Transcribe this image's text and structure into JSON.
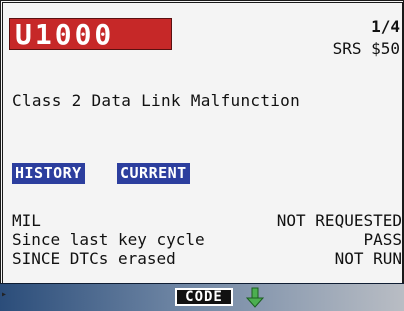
{
  "dtc": {
    "code": "U1000",
    "page": "1/4",
    "module": "SRS $50",
    "description": "Class 2 Data Link Malfunction"
  },
  "badges": {
    "history": "HISTORY",
    "current": "CURRENT",
    "color": "#2c3e9e"
  },
  "status_rows": [
    {
      "label": "MIL",
      "value": "NOT REQUESTED"
    },
    {
      "label": "Since last key cycle",
      "value": "PASS"
    },
    {
      "label": "SINCE DTCs erased",
      "value": "NOT RUN"
    }
  ],
  "bottom_bar": {
    "code_button": "CODE",
    "down_icon": "arrow-down-icon",
    "pointer": "▸"
  },
  "colors": {
    "code_background": "#c62828",
    "arrow": "#4caf50"
  }
}
